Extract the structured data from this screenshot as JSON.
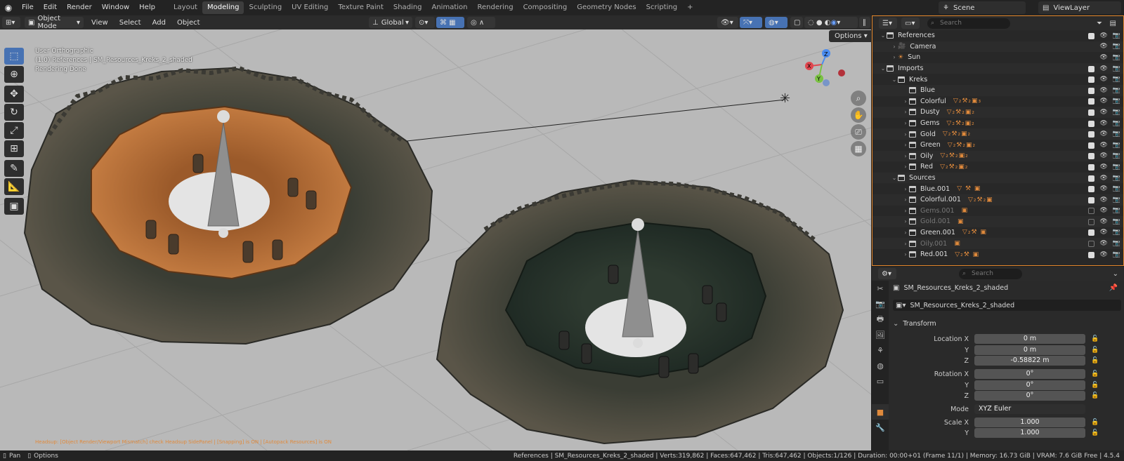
{
  "topbar": {
    "menus": [
      "File",
      "Edit",
      "Render",
      "Window",
      "Help"
    ],
    "workspaces": [
      "Layout",
      "Modeling",
      "Sculpting",
      "UV Editing",
      "Texture Paint",
      "Shading",
      "Animation",
      "Rendering",
      "Compositing",
      "Geometry Nodes",
      "Scripting"
    ],
    "active_workspace": "Modeling",
    "add_tab": "+",
    "scene": "Scene",
    "view_layer": "ViewLayer"
  },
  "viewport_header": {
    "mode": "Object Mode",
    "menus": [
      "View",
      "Select",
      "Add",
      "Object"
    ],
    "orientation": "Global",
    "options": "Options"
  },
  "viewport": {
    "info_lines": [
      "User Orthographic",
      "(1.0) References | SM_Resources_Kreks_2_shaded",
      "Rendering Done"
    ],
    "hint": "Headsup: [Object Render/Viewport Mismatch] check Headsup SidePanel | [Snapping] is ON | [Autopack Resources] is ON",
    "gizmo": {
      "x": "X",
      "y": "Y",
      "z": "Z"
    }
  },
  "outliner": {
    "search_placeholder": "Search",
    "rows": [
      {
        "indent": 0,
        "arrow": "v",
        "type": "collection",
        "name": "References",
        "badges": "",
        "checked": true,
        "dim": false
      },
      {
        "indent": 1,
        "arrow": ">",
        "type": "camera",
        "name": "Camera",
        "badges": "",
        "checked": false,
        "dim": false
      },
      {
        "indent": 1,
        "arrow": ">",
        "type": "light",
        "name": "Sun",
        "badges": "",
        "checked": false,
        "dim": false
      },
      {
        "indent": 0,
        "arrow": "v",
        "type": "collection",
        "name": "Imports",
        "badges": "",
        "checked": true,
        "dim": false
      },
      {
        "indent": 1,
        "arrow": "v",
        "type": "collection",
        "name": "Kreks",
        "badges": "",
        "checked": true,
        "dim": false
      },
      {
        "indent": 2,
        "arrow": "",
        "type": "collection",
        "name": "Blue",
        "badges": "",
        "checked": true,
        "dim": false
      },
      {
        "indent": 2,
        "arrow": ">",
        "type": "collection",
        "name": "Colorful",
        "badges": "▽₂⚒₂▣₃",
        "checked": true,
        "dim": false
      },
      {
        "indent": 2,
        "arrow": ">",
        "type": "collection",
        "name": "Dusty",
        "badges": "▽₂⚒₂▣₂",
        "checked": true,
        "dim": false
      },
      {
        "indent": 2,
        "arrow": ">",
        "type": "collection",
        "name": "Gems",
        "badges": "▽₂⚒₂▣₂",
        "checked": true,
        "dim": false
      },
      {
        "indent": 2,
        "arrow": ">",
        "type": "collection",
        "name": "Gold",
        "badges": "▽₂⚒₂▣₂",
        "checked": true,
        "dim": false
      },
      {
        "indent": 2,
        "arrow": ">",
        "type": "collection",
        "name": "Green",
        "badges": "▽₂⚒₂▣₂",
        "checked": true,
        "dim": false
      },
      {
        "indent": 2,
        "arrow": ">",
        "type": "collection",
        "name": "Oily",
        "badges": "▽₂⚒₂▣₂",
        "checked": true,
        "dim": false
      },
      {
        "indent": 2,
        "arrow": ">",
        "type": "collection",
        "name": "Red",
        "badges": "▽₂⚒₂▣₂",
        "checked": true,
        "dim": false
      },
      {
        "indent": 1,
        "arrow": "v",
        "type": "collection",
        "name": "Sources",
        "badges": "",
        "checked": true,
        "dim": false
      },
      {
        "indent": 2,
        "arrow": ">",
        "type": "collection",
        "name": "Blue.001",
        "badges": "▽ ⚒ ▣",
        "checked": true,
        "dim": false
      },
      {
        "indent": 2,
        "arrow": ">",
        "type": "collection",
        "name": "Colorful.001",
        "badges": "▽₂⚒₂▣",
        "checked": true,
        "dim": false
      },
      {
        "indent": 2,
        "arrow": ">",
        "type": "collection",
        "name": "Gems.001",
        "badges": "▣",
        "checked": false,
        "dim": true
      },
      {
        "indent": 2,
        "arrow": ">",
        "type": "collection",
        "name": "Gold.001",
        "badges": "▣",
        "checked": false,
        "dim": true
      },
      {
        "indent": 2,
        "arrow": ">",
        "type": "collection",
        "name": "Green.001",
        "badges": "▽₂⚒ ▣",
        "checked": true,
        "dim": false
      },
      {
        "indent": 2,
        "arrow": ">",
        "type": "collection",
        "name": "Oily.001",
        "badges": "▣",
        "checked": false,
        "dim": true
      },
      {
        "indent": 2,
        "arrow": ">",
        "type": "collection",
        "name": "Red.001",
        "badges": "▽₂⚒ ▣",
        "checked": true,
        "dim": false
      }
    ]
  },
  "properties": {
    "search_placeholder": "Search",
    "object_name": "SM_Resources_Kreks_2_shaded",
    "datablock_name": "SM_Resources_Kreks_2_shaded",
    "transform_label": "Transform",
    "fields": [
      {
        "label": "Location X",
        "value": "0 m"
      },
      {
        "label": "Y",
        "value": "0 m"
      },
      {
        "label": "Z",
        "value": "-0.58822 m"
      },
      {
        "label": "Rotation X",
        "value": "0°"
      },
      {
        "label": "Y",
        "value": "0°"
      },
      {
        "label": "Z",
        "value": "0°"
      },
      {
        "label": "Mode",
        "value": "XYZ Euler"
      },
      {
        "label": "Scale X",
        "value": "1.000"
      },
      {
        "label": "Y",
        "value": "1.000"
      }
    ]
  },
  "statusbar": {
    "left_items": [
      "Pan",
      "Options"
    ],
    "collection": "References",
    "object": "SM_Resources_Kreks_2_shaded",
    "verts": "Verts:319,862",
    "faces": "Faces:647,462",
    "tris": "Tris:647,462",
    "objects": "Objects:1/126",
    "duration": "Duration: 00:00+01 (Frame 11/1)",
    "memory": "Memory: 16.73 GiB",
    "vram": "VRAM: 7.6 GiB Free",
    "version": "4.5.4"
  },
  "colors": {
    "accent": "#e3862b",
    "active_blue": "#4772b3",
    "viewport_bg": "#b8b8b8"
  }
}
